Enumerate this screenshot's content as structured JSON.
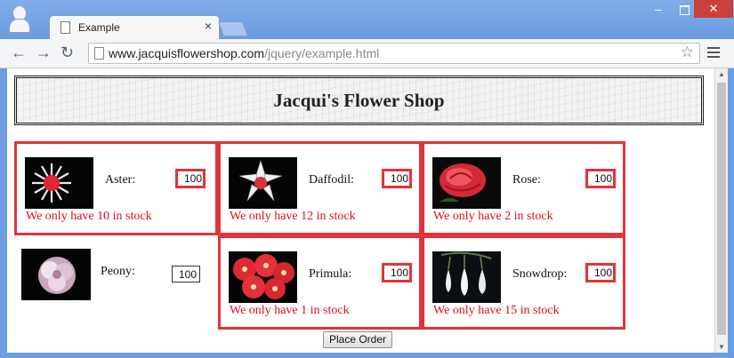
{
  "browser": {
    "tab_title": "Example",
    "tab_close": "×",
    "url_domain": "www.jacquisflowershop.com",
    "url_path": "/jquery/example.html",
    "win_min": "–",
    "win_close": "✕"
  },
  "page": {
    "heading": "Jacqui's Flower Shop",
    "order_button": "Place Order",
    "flowers": [
      {
        "name": "Aster:",
        "quantity": "100",
        "stock_message": "We only have 10 in stock",
        "flagged": true
      },
      {
        "name": "Daffodil:",
        "quantity": "100",
        "stock_message": "We only have 12 in stock",
        "flagged": true
      },
      {
        "name": "Rose:",
        "quantity": "100",
        "stock_message": "We only have 2 in stock",
        "flagged": true
      },
      {
        "name": "Peony:",
        "quantity": "100",
        "stock_message": "",
        "flagged": false
      },
      {
        "name": "Primula:",
        "quantity": "100",
        "stock_message": "We only have 1 in stock",
        "flagged": true
      },
      {
        "name": "Snowdrop:",
        "quantity": "100",
        "stock_message": "We only have 15 in stock",
        "flagged": true
      }
    ]
  },
  "colors": {
    "error_red": "#e2333a",
    "stock_text": "#d8111a",
    "window_blue": "#6d9ce0"
  }
}
